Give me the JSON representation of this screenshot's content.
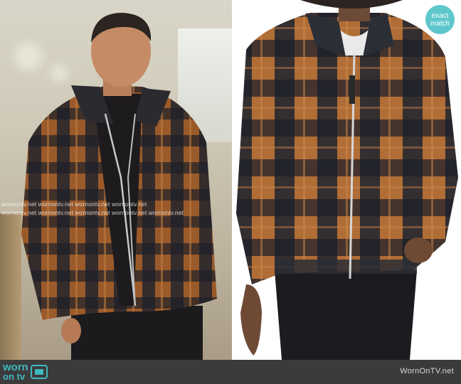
{
  "badge": {
    "line1": "exact",
    "line2": "match"
  },
  "watermark": {
    "row1": "wornontv.net  wornontv.net  wornontv.net  wornontv.net",
    "row2": "wornontv.net  wornontv.net  wornontv.net  wornontv.net  wornontv.net"
  },
  "footer": {
    "logo_line1": "worn",
    "logo_line2": "on tv",
    "site": "WornOnTV.net",
    "background": "#3c3b3b",
    "accent": "#3fb8bf"
  },
  "colors": {
    "badge": "#5ec7cc",
    "plaid_rust": "#a8662f",
    "plaid_navy": "#1c202a"
  }
}
